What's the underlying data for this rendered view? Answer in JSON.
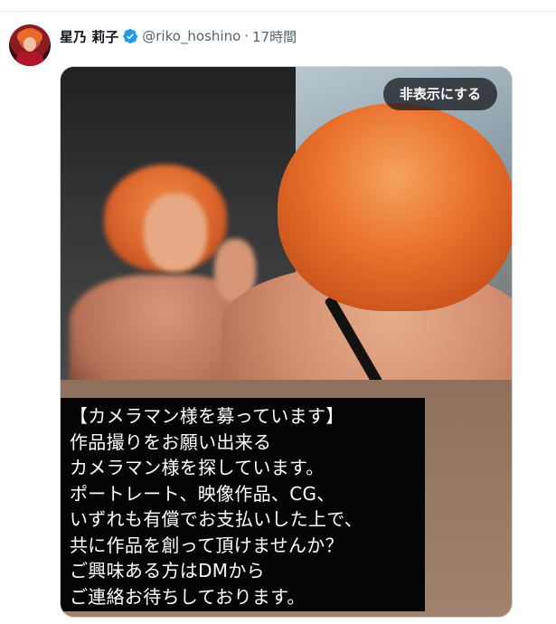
{
  "tweet": {
    "author": {
      "display_name": "星乃 莉子",
      "handle": "@riko_hoshino",
      "verified": true
    },
    "separator": "·",
    "time": "17時間",
    "media": {
      "hide_button_label": "非表示にする",
      "text_lines": [
        "【カメラマン様を募っています】",
        "作品撮りをお願い出来る",
        "カメラマン様を探しています。",
        "ポートレート、映像作品、CG、",
        "いずれも有償でお支払いした上で、",
        "共に作品を創って頂けませんか？",
        "ご興味ある方はDMから",
        "ご連絡お待ちしております。"
      ]
    }
  },
  "colors": {
    "verified_badge": "#1d9bf0",
    "secondary_text": "#536471",
    "primary_text": "#0f1419"
  },
  "icons": {
    "verified": "verified-badge-icon",
    "avatar": "profile-avatar"
  }
}
